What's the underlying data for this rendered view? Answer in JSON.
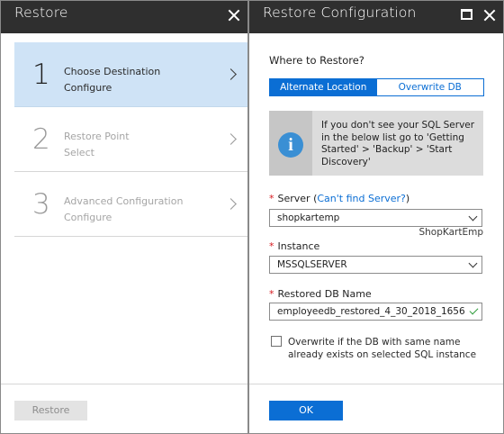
{
  "left_blade": {
    "title": "Restore",
    "steps": [
      {
        "number": "1",
        "title": "Choose Destination",
        "subtitle": "Configure",
        "state": "active"
      },
      {
        "number": "2",
        "title": "Restore Point",
        "subtitle": "Select",
        "state": "disabled"
      },
      {
        "number": "3",
        "title": "Advanced Configuration",
        "subtitle": "Configure",
        "state": "disabled"
      }
    ],
    "restore_button": "Restore"
  },
  "right_blade": {
    "title": "Restore Configuration",
    "where_label": "Where to Restore?",
    "tabs": [
      {
        "label": "Alternate Location",
        "selected": true
      },
      {
        "label": "Overwrite DB",
        "selected": false
      }
    ],
    "info_icon": "info-icon",
    "info_text": "If you don't see your SQL Server in the below list go to 'Getting Started' > 'Backup' > 'Start Discovery'",
    "server_label": "Server",
    "server_link_open": " (",
    "server_link": "Can't find Server?",
    "server_link_close": ")",
    "server_value": "shopkartemp",
    "server_hint": "ShopKartEmp",
    "instance_label": "Instance",
    "instance_value": "MSSQLSERVER",
    "dbname_label": "Restored DB Name",
    "dbname_value": "employeedb_restored_4_30_2018_1656",
    "required_marker": "*",
    "overwrite_checkbox_label": "Overwrite if the DB with same name already exists on selected SQL instance",
    "overwrite_checked": false,
    "ok_button": "OK"
  },
  "colors": {
    "accent": "#0b6ed4",
    "header": "#2f2f2f",
    "active_step": "#cfe3f6",
    "required": "#d6181e",
    "valid_check": "#2e9b3a"
  }
}
